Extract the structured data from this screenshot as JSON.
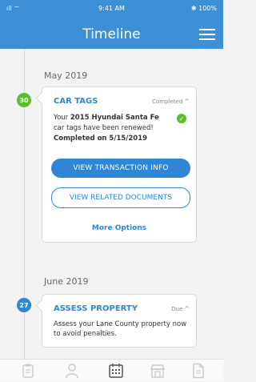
{
  "status_bar": {
    "signal": "ıll ⌔",
    "time": "9:41 AM",
    "battery": "✱ 100%"
  },
  "header": {
    "title": "Timeline"
  },
  "timeline": {
    "sections": [
      {
        "month": "May 2019",
        "badge": "30",
        "card": {
          "title": "CAR TAGS",
          "status": "Completed",
          "text_prefix": "Your ",
          "vehicle": "2015 Hyundai Santa Fe",
          "text_suffix": "car tags have been renewed!",
          "completed_line": "Completed on 5/15/2019",
          "primary_button": "VIEW TRANSACTION INFO",
          "secondary_button": "VIEW RELATED DOCUMENTS",
          "more_options": "More Options"
        }
      },
      {
        "month": "June 2019",
        "badge": "27",
        "card": {
          "title": "ASSESS PROPERTY",
          "status": "Due",
          "text": "Assess your Lane County property now to avoid penalties."
        }
      }
    ]
  },
  "bottom_nav": {
    "tabs": [
      "clipboard-icon",
      "person-icon",
      "calendar-icon",
      "store-icon",
      "document-icon"
    ]
  },
  "colors": {
    "primary": "#2f86d4",
    "header": "#3d8fd6",
    "success": "#5bbf2a"
  }
}
